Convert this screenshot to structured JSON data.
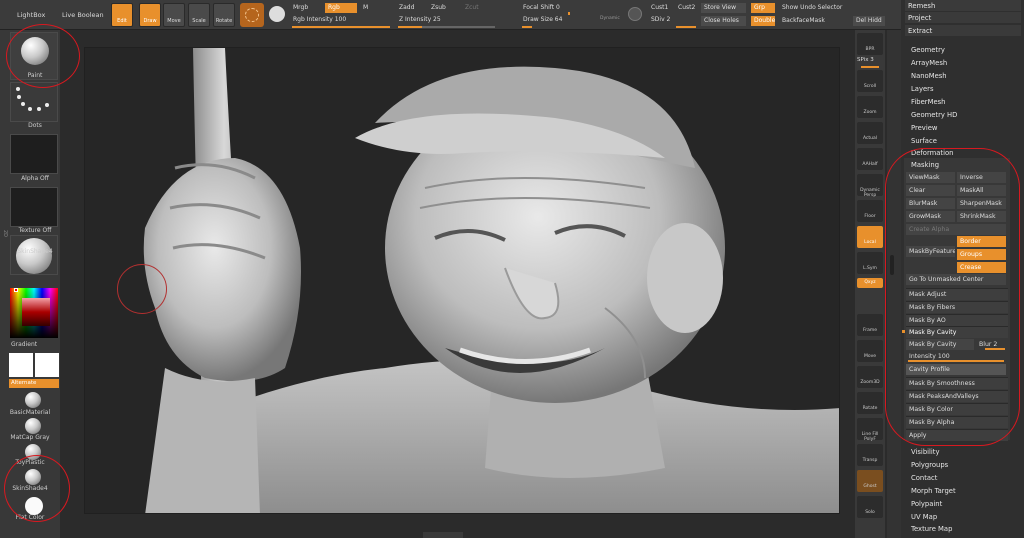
{
  "top": {
    "lightbox": "LightBox",
    "live_boolean": "Live Boolean",
    "edit": "Edit",
    "draw": "Draw",
    "move": "Move",
    "scale": "Scale",
    "rotate": "Rotate",
    "mrgb": "Mrgb",
    "rgb": "Rgb",
    "m": "M",
    "rgb_intensity": "Rgb Intensity 100",
    "zadd": "Zadd",
    "zsub": "Zsub",
    "zcut": "Zcut",
    "z_intensity": "Z Intensity 25",
    "focal_shift": "Focal Shift 0",
    "draw_size": "Draw Size 64",
    "dynamic": "Dynamic",
    "cust1": "Cust1",
    "cust2": "Cust2",
    "sdiv": "SDiv 2",
    "store_view": "Store View",
    "close_holes": "Close Holes",
    "grp": "Grp",
    "double": "Double",
    "show_undo": "Show Undo Selector",
    "backface": "BackfaceMask",
    "del_hidd": "Del Hidd"
  },
  "left": {
    "paint": "Paint",
    "dots": "Dots",
    "alpha_off": "Alpha Off",
    "texture_off": "Texture Off",
    "skinshade4": "SkinShade4",
    "gradient": "Gradient",
    "alternate": "Alternate",
    "basic_material": "BasicMaterial",
    "matcap_gray": "MatCap Gray",
    "toy_plastic": "ToyPlastic",
    "skinshade4_b": "SkinShade4",
    "flat_color": "Flat Color",
    "side_label": "2D"
  },
  "shelf": [
    "BPR",
    "SPix 3",
    "Scroll",
    "Zoom",
    "Actual",
    "AAHalf",
    "Dynamic Persp",
    "Floor",
    "Local",
    "L.Sym",
    "Qxyz",
    "",
    "",
    "Frame",
    "Move",
    "Zoom3D",
    "Rotate",
    "Line Fill PolyF",
    "Transp",
    "Ghost",
    "Solo",
    "Dynamic"
  ],
  "palette": {
    "remesh": "Remesh",
    "project": "Project",
    "extract": "Extract",
    "geometry": "Geometry",
    "arraymesh": "ArrayMesh",
    "nanomesh": "NanoMesh",
    "layers": "Layers",
    "fibermesh": "FiberMesh",
    "geometry_hd": "Geometry HD",
    "preview": "Preview",
    "surface": "Surface",
    "deformation": "Deformation",
    "masking": "Masking",
    "viewmask": "ViewMask",
    "inverse": "Inverse",
    "clear": "Clear",
    "maskall": "MaskAll",
    "blurmask": "BlurMask",
    "sharpenmask": "SharpenMask",
    "growmask": "GrowMask",
    "shrinkmask": "ShrinkMask",
    "create_alpha": "Create Alpha",
    "mask_by_feature": "MaskByFeature",
    "border": "Border",
    "groups": "Groups",
    "crease": "Crease",
    "go_unmasked": "Go To Unmasked Center",
    "mask_adjust": "Mask Adjust",
    "mask_by_fibers": "Mask By Fibers",
    "mask_by_ao": "Mask By AO",
    "mask_by_cavity_hdr": "Mask By Cavity",
    "mask_by_cavity_btn": "Mask By Cavity",
    "blur": "Blur 2",
    "intensity": "Intensity 100",
    "cavity_profile": "Cavity Profile",
    "mask_by_smoothness": "Mask By Smoothness",
    "mask_peaks": "Mask PeaksAndValleys",
    "mask_by_color": "Mask By Color",
    "mask_by_alpha": "Mask By Alpha",
    "apply": "Apply",
    "visibility": "Visibility",
    "polygroups": "Polygroups",
    "contact": "Contact",
    "morph_target": "Morph Target",
    "polypaint": "Polypaint",
    "uv_map": "UV Map",
    "texture_map": "Texture Map"
  },
  "colors": {
    "accent": "#e8902c",
    "annotation": "#d71920"
  },
  "levels": {
    "rgb_intensity": 100,
    "z_intensity": 25,
    "draw_size": 64,
    "focal_shift": 0,
    "intensity": 100,
    "blur": 2
  }
}
